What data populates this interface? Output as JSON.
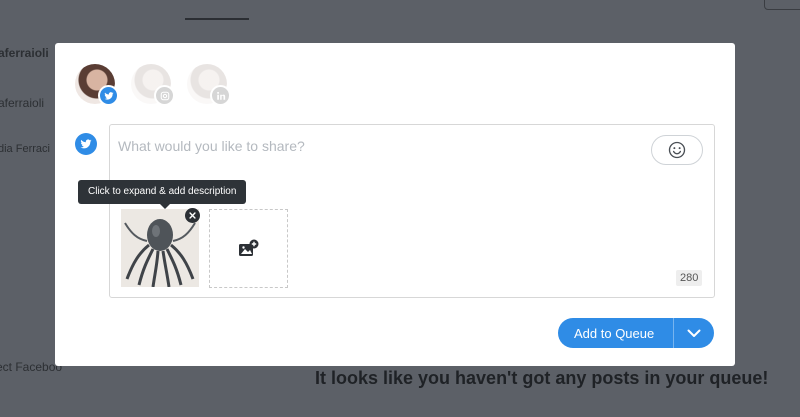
{
  "background": {
    "items": [
      {
        "text": "aferraioli"
      },
      {
        "text": "aferraioli"
      },
      {
        "text": "dia Ferraci"
      },
      {
        "text": "ect Faceboo"
      }
    ],
    "headline": "It looks like you haven't got any posts in your queue!"
  },
  "composer": {
    "profiles": [
      {
        "network": "twitter",
        "icon": "twitter-icon",
        "active": true
      },
      {
        "network": "instagram",
        "icon": "instagram-icon",
        "active": false
      },
      {
        "network": "linkedin",
        "icon": "linkedin-icon",
        "active": false
      }
    ],
    "network_indicator": "twitter-icon",
    "placeholder": "What would you like to share?",
    "emoji_icon": "emoji-icon",
    "tooltip": "Click to expand & add description",
    "media_thumbnail": "octopus-illustration",
    "add_media_icon": "add-image-icon",
    "char_count": "280",
    "submit_label": "Add to Queue",
    "submit_dropdown_icon": "chevron-down-icon"
  },
  "colors": {
    "accent": "#2f8ce6",
    "overlay": "#5c6067",
    "tooltip_bg": "#2e3338"
  }
}
